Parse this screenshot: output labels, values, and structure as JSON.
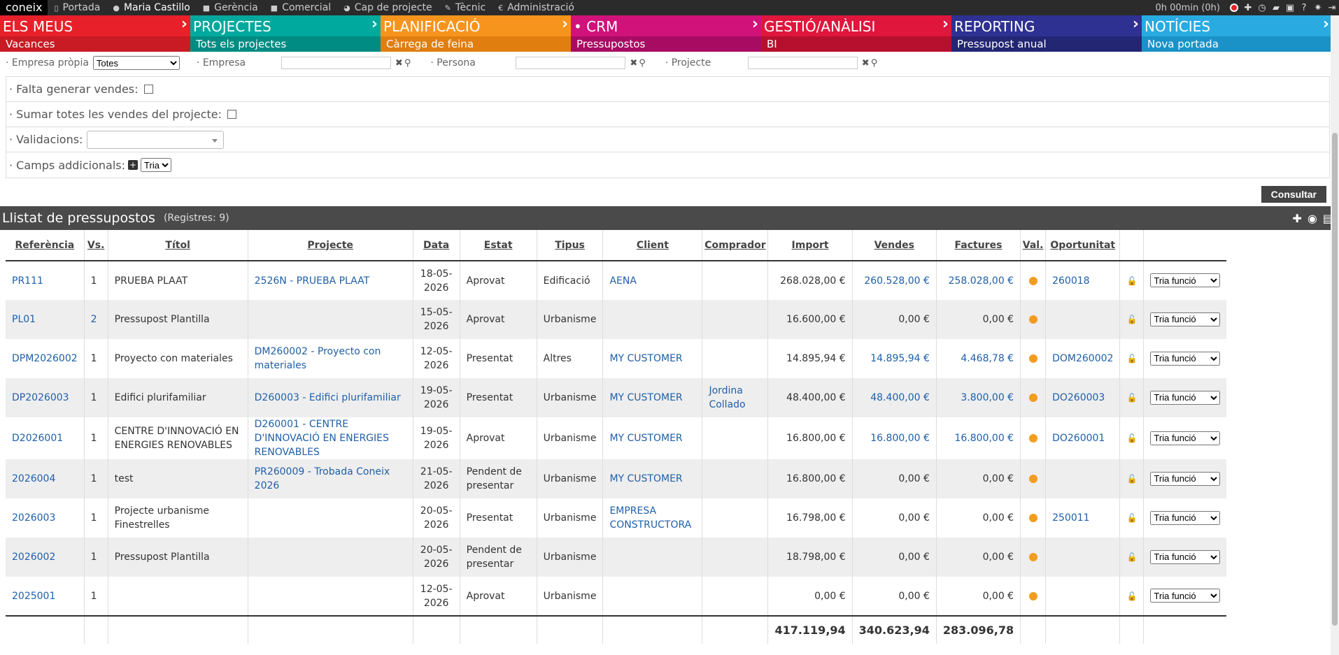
{
  "topbar": {
    "logo": "coneix",
    "nav": [
      {
        "icon": "page-icon",
        "glyph": "▯",
        "label": "Portada"
      },
      {
        "icon": "user-icon",
        "glyph": "●",
        "label": "Maria Castillo"
      },
      {
        "icon": "briefcase-icon",
        "glyph": "■",
        "label": "Gerència"
      },
      {
        "icon": "case-icon",
        "glyph": "■",
        "label": "Comercial"
      },
      {
        "icon": "pie-icon",
        "glyph": "◕",
        "label": "Cap de projecte"
      },
      {
        "icon": "wrench-icon",
        "glyph": "✎",
        "label": "Tècnic"
      },
      {
        "icon": "euro-icon",
        "glyph": "€",
        "label": "Administració"
      }
    ],
    "timer": "0h 00min (0h)"
  },
  "modules": [
    {
      "title": "ELS MEUS",
      "sub": "Vacances",
      "color": "#e8202a",
      "subcolor": "#c81b24"
    },
    {
      "title": "PROJECTES",
      "sub": "Tots els projectes",
      "color": "#00a99d",
      "subcolor": "#008c82"
    },
    {
      "title": "PLANIFICACIÓ",
      "sub": "Càrrega de feina",
      "color": "#f7941d",
      "subcolor": "#e07e10"
    },
    {
      "title": "•   CRM",
      "sub": "Pressupostos",
      "color": "#d1127a",
      "subcolor": "#a80c62"
    },
    {
      "title": "GESTIÓ/ANÀLISI",
      "sub": "BI",
      "color": "#e0163c",
      "subcolor": "#b7102f"
    },
    {
      "title": "REPORTING",
      "sub": "Pressupost anual",
      "color": "#2e3192",
      "subcolor": "#232673"
    },
    {
      "title": "NOTÍCIES",
      "sub": "Nova portada",
      "color": "#29abe2",
      "subcolor": "#1a92c7"
    }
  ],
  "filters": {
    "empresa_propia_label": "· Empresa pròpia",
    "empresa_propia_value": "Totes",
    "empresa_label": "· Empresa",
    "persona_label": "· Persona",
    "projecte_label": "· Projecte"
  },
  "options": {
    "falta_label": "· Falta generar vendes:",
    "sumar_label": "· Sumar totes les vendes del projecte:",
    "validacions_label": "· Validacions:",
    "camps_label": "· Camps addicionals:",
    "camps_select": "Tria"
  },
  "consultar_label": "Consultar",
  "list": {
    "title": "Llistat de pressupostos",
    "count": "(Registres: 9)"
  },
  "columns": [
    "Referència",
    "Vs.",
    "Títol",
    "Projecte",
    "Data",
    "Estat",
    "Tipus",
    "Client",
    "Comprador",
    "Import",
    "Vendes",
    "Factures",
    "Val.",
    "Oportunitat",
    "",
    ""
  ],
  "rows": [
    {
      "ref": "PR111",
      "vs": "1",
      "titol": "PRUEBA PLAAT",
      "projecte": "2526N - PRUEBA PLAAT",
      "data": "18-05-2026",
      "estat": "Aprovat",
      "tipus": "Edificació",
      "client": "AENA",
      "comprador": "",
      "import": "268.028,00 €",
      "vendes": "260.528,00 €",
      "factures": "258.028,00 €",
      "oportunitat": "260018",
      "funcio": "Tria funció"
    },
    {
      "ref": "PL01",
      "vs": "2",
      "titol": "Pressupost Plantilla",
      "projecte": "",
      "data": "15-05-2026",
      "estat": "Aprovat",
      "tipus": "Urbanisme",
      "client": "",
      "comprador": "",
      "import": "16.600,00 €",
      "vendes": "0,00 €",
      "factures": "0,00 €",
      "oportunitat": "",
      "funcio": "Tria funció"
    },
    {
      "ref": "DPM2026002",
      "vs": "1",
      "titol": "Proyecto con materiales",
      "projecte": "DM260002 - Proyecto con materiales",
      "data": "12-05-2026",
      "estat": "Presentat",
      "tipus": "Altres",
      "client": "MY CUSTOMER",
      "comprador": "",
      "import": "14.895,94 €",
      "vendes": "14.895,94 €",
      "factures": "4.468,78 €",
      "oportunitat": "DOM260002",
      "funcio": "Tria funció"
    },
    {
      "ref": "DP2026003",
      "vs": "1",
      "titol": "Edifici plurifamiliar",
      "projecte": "D260003 - Edifici plurifamiliar",
      "data": "19-05-2026",
      "estat": "Presentat",
      "tipus": "Urbanisme",
      "client": "MY CUSTOMER",
      "comprador": "Jordina Collado",
      "import": "48.400,00 €",
      "vendes": "48.400,00 €",
      "factures": "3.800,00 €",
      "oportunitat": "DO260003",
      "funcio": "Tria funció"
    },
    {
      "ref": "D2026001",
      "vs": "1",
      "titol": "CENTRE D'INNOVACIÓ EN ENERGIES RENOVABLES",
      "projecte": "D260001 - CENTRE D'INNOVACIÓ EN ENERGIES RENOVABLES",
      "data": "19-05-2026",
      "estat": "Aprovat",
      "tipus": "Urbanisme",
      "client": "MY CUSTOMER",
      "comprador": "",
      "import": "16.800,00 €",
      "vendes": "16.800,00 €",
      "factures": "16.800,00 €",
      "oportunitat": "DO260001",
      "funcio": "Tria funció"
    },
    {
      "ref": "2026004",
      "vs": "1",
      "titol": "test",
      "projecte": "PR260009 - Trobada Coneix 2026",
      "data": "21-05-2026",
      "estat": "Pendent de presentar",
      "tipus": "Urbanisme",
      "client": "MY CUSTOMER",
      "comprador": "",
      "import": "16.800,00 €",
      "vendes": "0,00 €",
      "factures": "0,00 €",
      "oportunitat": "",
      "funcio": "Tria funció"
    },
    {
      "ref": "2026003",
      "vs": "1",
      "titol": "Projecte urbanisme Finestrelles",
      "projecte": "",
      "data": "20-05-2026",
      "estat": "Presentat",
      "tipus": "Urbanisme",
      "client": "EMPRESA CONSTRUCTORA",
      "comprador": "",
      "import": "16.798,00 €",
      "vendes": "0,00 €",
      "factures": "0,00 €",
      "oportunitat": "250011",
      "funcio": "Tria funció"
    },
    {
      "ref": "2026002",
      "vs": "1",
      "titol": "Pressupost Plantilla",
      "projecte": "",
      "data": "20-05-2026",
      "estat": "Pendent de presentar",
      "tipus": "Urbanisme",
      "client": "",
      "comprador": "",
      "import": "18.798,00 €",
      "vendes": "0,00 €",
      "factures": "0,00 €",
      "oportunitat": "",
      "funcio": "Tria funció"
    },
    {
      "ref": "2025001",
      "vs": "1",
      "titol": "",
      "projecte": "",
      "data": "12-05-2026",
      "estat": "Aprovat",
      "tipus": "Urbanisme",
      "client": "",
      "comprador": "",
      "import": "0,00 €",
      "vendes": "0,00 €",
      "factures": "0,00 €",
      "oportunitat": "",
      "funcio": "Tria funció"
    }
  ],
  "totals": {
    "import": "417.119,94",
    "vendes": "340.623,94",
    "factures": "283.096,78"
  },
  "colors": {
    "link": "#1f5fa8",
    "status_dot": "#f39c1f"
  }
}
